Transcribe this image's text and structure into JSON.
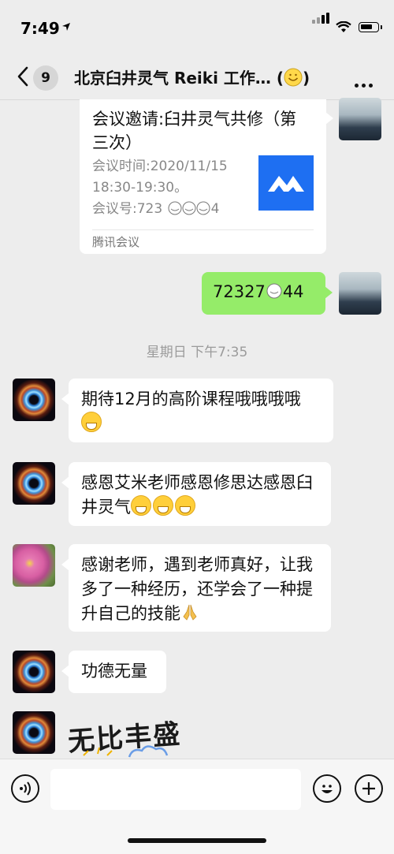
{
  "status_bar": {
    "time": "7:49"
  },
  "header": {
    "badge_count": "9",
    "title": "北京臼井灵气 Reiki 工作… ("
  },
  "messages": {
    "card": {
      "title": "会议邀请:臼井灵气共修（第三次）",
      "time_line": "会议时间:2020/11/15 18:30-19:30。",
      "id_line": "会议号:723 ",
      "id_suffix": "4",
      "source": "腾讯会议"
    },
    "sent_text_a": "72327",
    "sent_text_b": "44",
    "timestamp": "星期日 下午7:35",
    "m1_text": "期待12月的高阶课程哦哦哦哦",
    "m2_text": "感恩艾米老师感恩修思达感恩臼井灵气",
    "m3_text": "感谢老师，遇到老师真好，让我多了一种经历，还学会了一种提升自己的技能",
    "m4_text": "功德无量",
    "sticker_text": "无比丰盛"
  },
  "icons": {
    "back": "chevron-left-icon",
    "more": "more-dots-icon",
    "voice": "voice-icon",
    "emoji": "emoji-icon",
    "plus": "plus-icon"
  },
  "colors": {
    "background": "#ededed",
    "sent_bubble": "#95ec69",
    "received_bubble": "#ffffff",
    "meeting_logo": "#1e6ff2"
  }
}
